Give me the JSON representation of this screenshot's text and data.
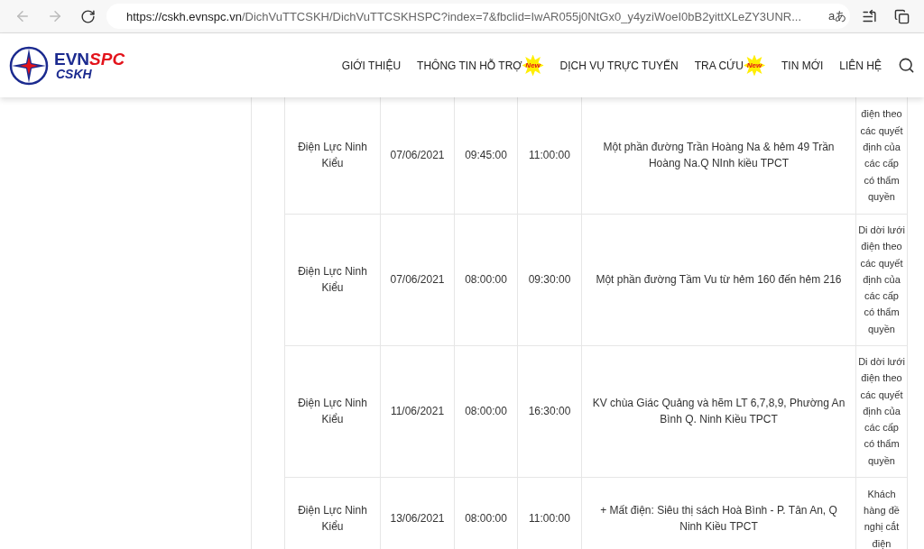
{
  "browser": {
    "url_host": "https://cskh.evnspc.vn",
    "url_path": "/DichVuTTCSKH/DichVuTTCSKHSPC?index=7&fbclid=IwAR055j0NtGx0_y4yziWoeI0bB2yittXLeZY3UNR...",
    "read_aloud": "aあ",
    "back_disabled": true
  },
  "logo": {
    "brand_a": "EVN",
    "brand_b": "SPC",
    "sub": "CSKH"
  },
  "nav": [
    {
      "label": "GIỚI THIỆU"
    },
    {
      "label": "THÔNG TIN HỖ TRỢ",
      "badge": "New"
    },
    {
      "label": "DỊCH VỤ TRỰC TUYẾN"
    },
    {
      "label": "TRA CỨU",
      "badge": "New"
    },
    {
      "label": "TIN MỚI"
    },
    {
      "label": "LIÊN HỆ"
    }
  ],
  "table": {
    "rows": [
      {
        "cells": [
          "Điện Lực Ninh Kiểu",
          "07/06/2021",
          "09:45:00",
          "11:00:00",
          "Một phần đường Trần Hoàng Na & hẻm 49 Trần Hoàng Na.Q NInh kiều TPCT",
          "điện theo các quyết định của các cấp có thẩm quyền"
        ]
      },
      {
        "cells": [
          "Điện Lực Ninh Kiểu",
          "07/06/2021",
          "08:00:00",
          "09:30:00",
          "Một phần đường Tầm Vu từ hẻm 160 đến hẻm 216",
          "Di dời lưới điện theo các quyết định của các cấp có thẩm quyền"
        ]
      },
      {
        "cells": [
          "Điện Lực Ninh Kiểu",
          "11/06/2021",
          "08:00:00",
          "16:30:00",
          "KV chùa Giác Quảng và hẽm LT 6,7,8,9, Phường An Bình Q. Ninh Kiều TPCT",
          "Di dời lưới điện theo các quyết định của các cấp có thẩm quyền"
        ]
      },
      {
        "cells": [
          "Điện Lực Ninh Kiểu",
          "13/06/2021",
          "08:00:00",
          "11:00:00",
          "+ Mất điện: Siêu thị sách Hoà Bình - P. Tân An, Q Ninh Kiều TPCT",
          "Khách hàng đề nghị cắt điện"
        ]
      }
    ]
  }
}
